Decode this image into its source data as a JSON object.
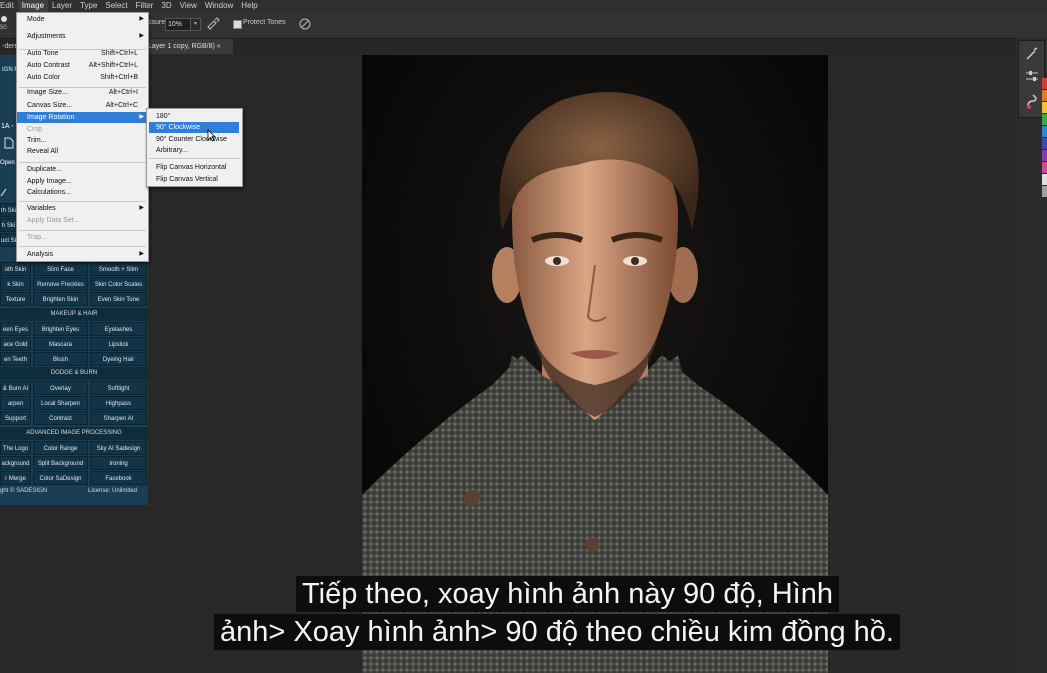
{
  "menubar": {
    "items": [
      "Edit",
      "Image",
      "Layer",
      "Type",
      "Select",
      "Filter",
      "3D",
      "View",
      "Window",
      "Help"
    ],
    "active": "Image"
  },
  "options_bar": {
    "flow_label": "ssure:",
    "flow_value": "10%",
    "protect_tones_label": "Protect Tones",
    "brush_size": "50"
  },
  "document_tab": {
    "partial_label": "-derr",
    "title": "Layer 1 copy, RGB/8) «"
  },
  "image_menu": {
    "items": [
      {
        "label": "Mode",
        "submenu": true
      },
      {
        "label": "Adjustments",
        "submenu": true
      },
      {
        "sep": true
      },
      {
        "label": "Auto Tone",
        "shortcut": "Shift+Ctrl+L"
      },
      {
        "label": "Auto Contrast",
        "shortcut": "Alt+Shift+Ctrl+L"
      },
      {
        "label": "Auto Color",
        "shortcut": "Shift+Ctrl+B"
      },
      {
        "sep": true
      },
      {
        "label": "Image Size...",
        "shortcut": "Alt+Ctrl+I"
      },
      {
        "label": "Canvas Size...",
        "shortcut": "Alt+Ctrl+C"
      },
      {
        "label": "Image Rotation",
        "submenu": true,
        "highlighted": true
      },
      {
        "label": "Crop",
        "disabled": true
      },
      {
        "label": "Trim..."
      },
      {
        "label": "Reveal All"
      },
      {
        "sep": true
      },
      {
        "label": "Duplicate..."
      },
      {
        "label": "Apply Image..."
      },
      {
        "label": "Calculations..."
      },
      {
        "sep": true
      },
      {
        "label": "Variables",
        "submenu": true
      },
      {
        "label": "Apply Data Set...",
        "disabled": true
      },
      {
        "sep": true
      },
      {
        "label": "Trap...",
        "disabled": true
      },
      {
        "sep": true
      },
      {
        "label": "Analysis",
        "submenu": true
      }
    ]
  },
  "rotation_submenu": {
    "items": [
      {
        "label": "180°"
      },
      {
        "label": "90° Clockwise",
        "highlighted": true
      },
      {
        "label": "90° Counter Clockwise"
      },
      {
        "label": "Arbitrary..."
      },
      {
        "sep": true
      },
      {
        "label": "Flip Canvas Horizontal"
      },
      {
        "label": "Flip Canvas Vertical"
      }
    ]
  },
  "plugin_panel": {
    "header_partial": "IGN R",
    "label_1a": "1A -",
    "open_label": "Open",
    "left_partial_buttons": [
      "th Ski",
      "h Ski",
      "uct Sk"
    ],
    "rows_skin": [
      [
        "oth Skin",
        "Slim Face",
        "Smooth + Slim"
      ],
      [
        "k Skin",
        "Remove Freckles",
        "Skin Color Scales"
      ],
      [
        "Texture",
        "Brighten Skin",
        "Even Skin Tone"
      ]
    ],
    "section_makeup": "MAKEUP & HAIR",
    "rows_makeup": [
      [
        "een Eyes",
        "Brighten Eyes",
        "Eyelashes"
      ],
      [
        "ace Gold",
        "Mascara",
        "Lipstick"
      ],
      [
        "en Teeth",
        "Blush",
        "Dyeing Hair"
      ]
    ],
    "section_dodge": "DODGE & BURN",
    "rows_dodge": [
      [
        "& Burn AI",
        "Overlay",
        "Softlight"
      ],
      [
        "arpen",
        "Local Sharpen",
        "Highpass"
      ],
      [
        "Support",
        "Contrast",
        "Sharpen AI"
      ]
    ],
    "section_advanced": "ADVANCED IMAGE PROCESSING",
    "rows_advanced": [
      [
        "The Logo",
        "Color Range",
        "Sky AI Sadesign"
      ],
      [
        "ackground",
        "Split Background",
        "Ironing"
      ],
      [
        "r Merge",
        "Color SaDesign",
        "Facebook"
      ]
    ],
    "footer_left": "ght © SADESIGN",
    "footer_right": "License: Unlimited"
  },
  "subtitles": {
    "line1": "Tiếp theo, xoay hình ảnh này 90 độ, Hình",
    "line2": "ảnh> Xoay hình ảnh> 90 độ theo chiều kim đồng hồ."
  },
  "colors": {
    "menu_highlight": "#2f7fd8",
    "plugin_bg": "#1a3f55",
    "swatches": [
      "#d23a3a",
      "#e07a2a",
      "#e8c82a",
      "#3aa84a",
      "#2a8ad0",
      "#3a4ab0",
      "#8a3ab0",
      "#d04a9a",
      "#e0e0e0",
      "#a0a0a0"
    ]
  }
}
